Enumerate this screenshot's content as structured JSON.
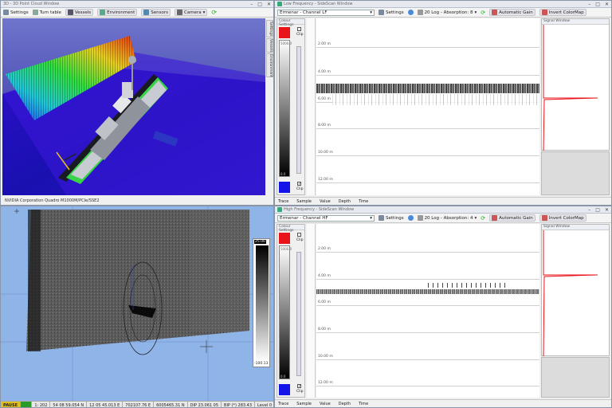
{
  "pointcloud": {
    "title": "3D - 3D Point Cloud Window",
    "toolbar": [
      "Settings",
      "Turn table",
      "Vessels",
      "Environment",
      "Sensors",
      "Camera"
    ],
    "side_tabs": [
      "Settings",
      "Vessels",
      "Environment"
    ],
    "status": "NVIDIA Corporation Quadro M1000M/PCIe/SSE2"
  },
  "low_freq": {
    "title": "Low Frequency - SideScan Window",
    "channel": "Ermenar - Channel LF",
    "settings": "Settings",
    "log": "20 Log - Absorption: 8",
    "gain": "Automatic Gain",
    "invert": "Invert ColorMap",
    "color_settings": "Colour Settings",
    "clip": "Clip",
    "scale_top": "5000.0",
    "scale_bottom": "0.0",
    "depths": [
      "2.00 m",
      "4.00 m",
      "6.00 m",
      "8.00 m",
      "10.00 m",
      "12.00 m"
    ],
    "signal_window": "Signal Window",
    "tabs": [
      "Trace",
      "Sample",
      "Value",
      "Depth",
      "Time"
    ]
  },
  "high_freq": {
    "title": "High Frequency - SideScan Window",
    "channel": "Ermenar - Channel HF",
    "settings": "Settings",
    "log": "20 Log - Absorption: 4",
    "gain": "Automatic Gain",
    "invert": "Invert ColorMap",
    "color_settings": "Colour Settings",
    "clip": "Clip",
    "scale_top": "5000.0",
    "scale_bottom": "0.0",
    "depths": [
      "2.00 m",
      "4.00 m",
      "6.00 m",
      "8.00 m",
      "10.00 m",
      "12.00 m"
    ],
    "signal_window": "Signal Window",
    "tabs": [
      "Trace",
      "Sample",
      "Value",
      "Depth",
      "Time"
    ]
  },
  "map": {
    "legend_top": "25.00",
    "legend_bottom": "-100.13",
    "status": [
      "PAUSE",
      "1: 202",
      "54 08 59.054 N",
      "12 05 45.013 E",
      "702107.76 E",
      "6005465.31 N",
      "DIP 23.061 05",
      "BIP (*) 283.43",
      "Level 0"
    ]
  },
  "colors": {
    "accent_red": "#e8141a",
    "accent_blue": "#1414e8",
    "sea": "#8fb4e8"
  }
}
